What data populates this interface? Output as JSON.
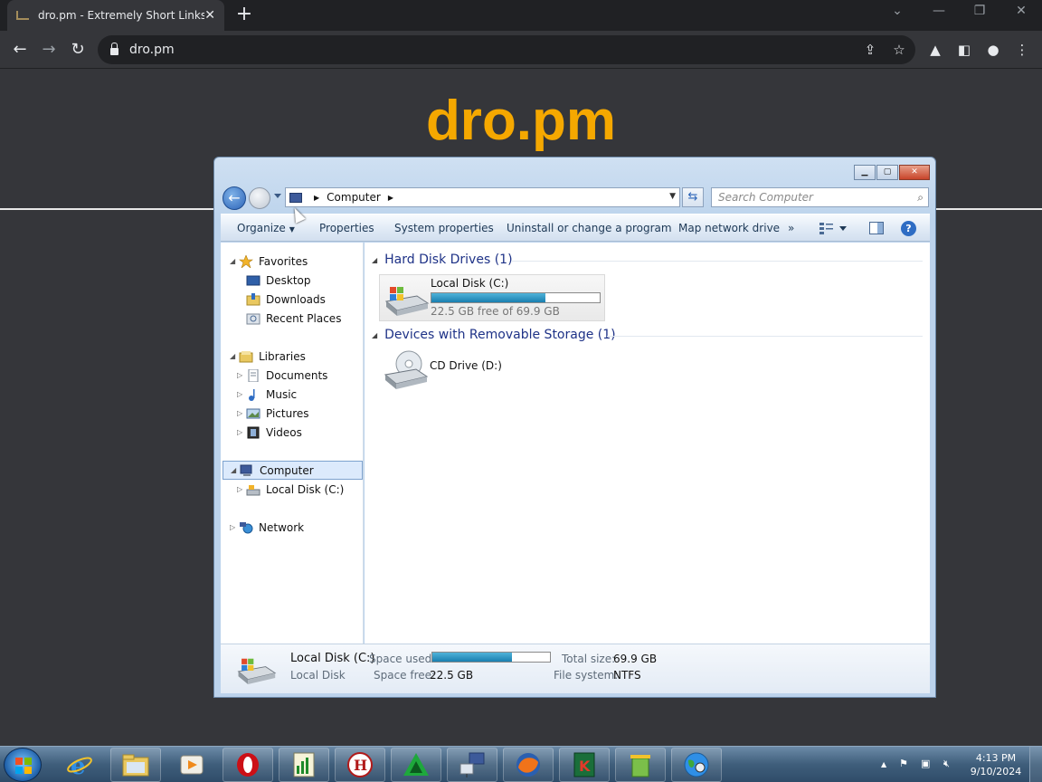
{
  "browser": {
    "tab_title": "dro.pm - Extremely Short Links",
    "tab_close": "✕",
    "new_tab": "+",
    "url": "dro.pm",
    "icons": [
      "back-icon",
      "forward-icon",
      "reload-icon",
      "lock-icon",
      "share-icon",
      "star-icon",
      "extension-icon",
      "sidepanel-icon",
      "profile-icon",
      "menu-icon"
    ]
  },
  "page": {
    "logo": "dro.pm"
  },
  "explorer": {
    "address": {
      "location": "Computer",
      "search_placeholder": "Search Computer"
    },
    "commands": {
      "organize": "Organize",
      "properties": "Properties",
      "system_properties": "System properties",
      "uninstall": "Uninstall or change a program",
      "map_drive": "Map network drive",
      "more": "»",
      "help": "?"
    },
    "nav": {
      "favorites": "Favorites",
      "desktop": "Desktop",
      "downloads": "Downloads",
      "recent_places": "Recent Places",
      "libraries": "Libraries",
      "documents": "Documents",
      "music": "Music",
      "pictures": "Pictures",
      "videos": "Videos",
      "computer": "Computer",
      "local_disk": "Local Disk (C:)",
      "network": "Network"
    },
    "groups": {
      "hdd": "Hard Disk Drives (1)",
      "removable": "Devices with Removable Storage (1)"
    },
    "drives": {
      "c_name": "Local Disk (C:)",
      "c_free": "22.5 GB free of 69.9 GB",
      "c_used_fraction": 0.678,
      "d_name": "CD Drive (D:)"
    },
    "details": {
      "name": "Local Disk (C:)",
      "type": "Local Disk",
      "space_used_label": "Space used:",
      "space_free_label": "Space free:",
      "space_free": "22.5 GB",
      "total_label": "Total size:",
      "total": "69.9 GB",
      "fs_label": "File system:",
      "fs": "NTFS"
    }
  },
  "taskbar": {
    "time": "4:13 PM",
    "date": "9/10/2024"
  }
}
